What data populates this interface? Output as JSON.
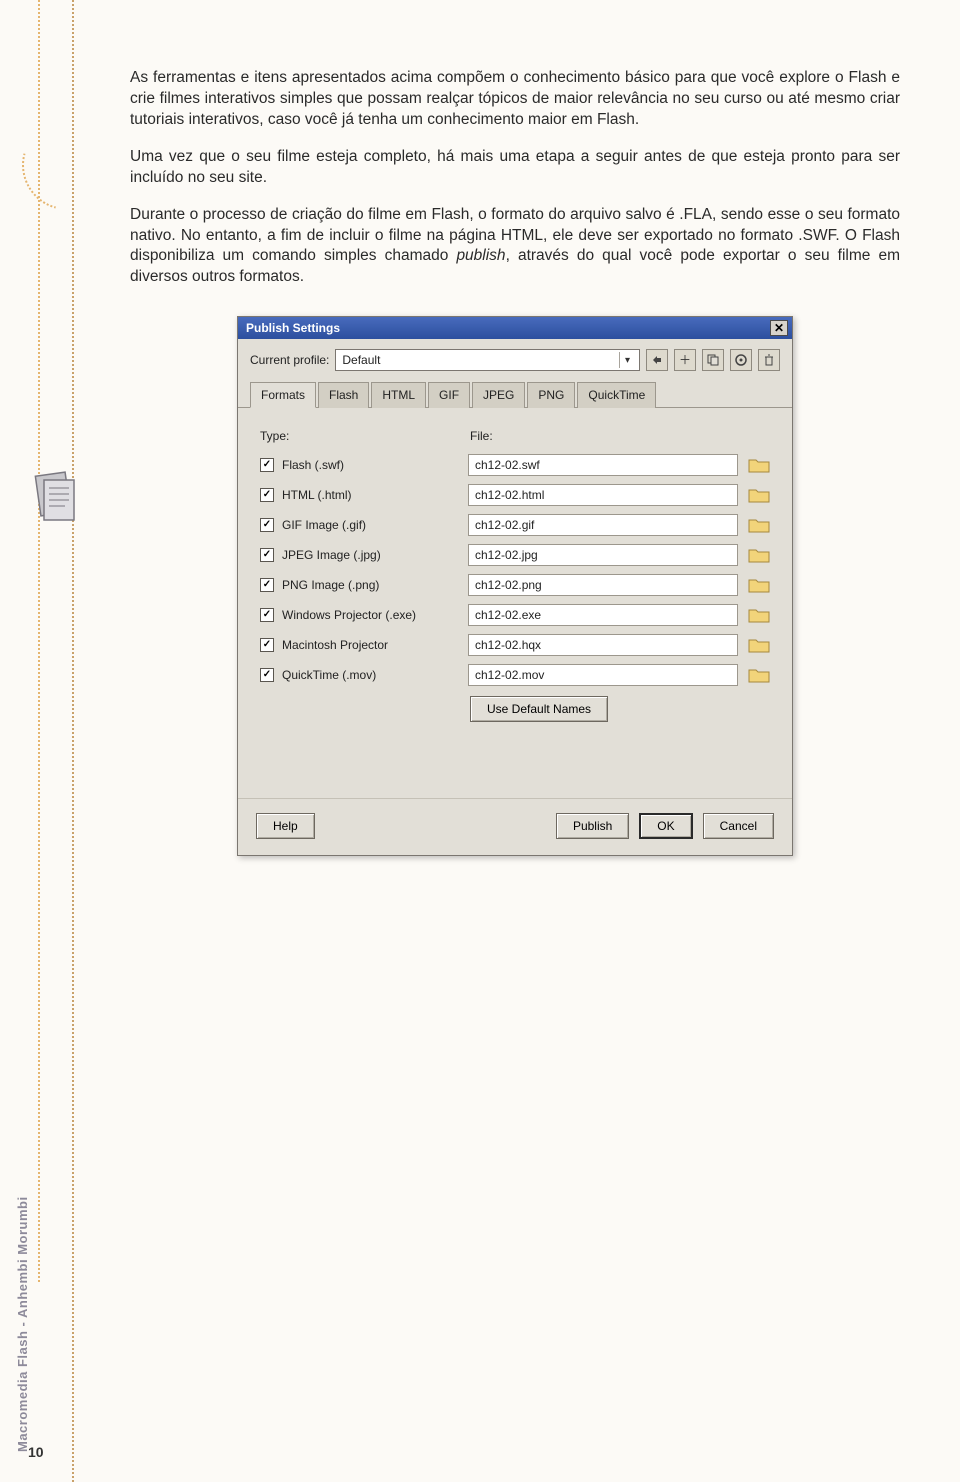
{
  "paragraphs": {
    "p1": "As ferramentas e itens apresentados acima compõem o conhecimento básico para que você explore o Flash e crie filmes interativos simples que possam realçar tópicos de maior relevância no seu curso ou até mesmo criar tutoriais interativos, caso você já tenha um conhecimento maior em Flash.",
    "p2": "Uma vez que o seu filme esteja completo, há mais uma etapa a seguir antes de que esteja pronto para ser incluído no seu site.",
    "p3_part1": "Durante o processo de criação do filme em Flash, o formato do arquivo salvo é .FLA, sendo esse o seu formato nativo. No entanto, a fim de incluir o filme na página HTML, ele deve ser exportado no formato .SWF. O Flash disponibiliza um comando simples chamado ",
    "p3_ital": "publish",
    "p3_part2": ", através do qual você pode exportar o seu filme em diversos outros formatos."
  },
  "sidebar": {
    "vertical_text": "Macromedia Flash - Anhembi Morumbi",
    "page_number": "10"
  },
  "dialog": {
    "title": "Publish Settings",
    "profile_label": "Current profile:",
    "profile_value": "Default",
    "tabs": [
      "Formats",
      "Flash",
      "HTML",
      "GIF",
      "JPEG",
      "PNG",
      "QuickTime"
    ],
    "col_type": "Type:",
    "col_file": "File:",
    "rows": [
      {
        "label": "Flash (.swf)",
        "file": "ch12-02.swf"
      },
      {
        "label": "HTML (.html)",
        "file": "ch12-02.html"
      },
      {
        "label": "GIF Image (.gif)",
        "file": "ch12-02.gif"
      },
      {
        "label": "JPEG Image (.jpg)",
        "file": "ch12-02.jpg"
      },
      {
        "label": "PNG Image (.png)",
        "file": "ch12-02.png"
      },
      {
        "label": "Windows Projector (.exe)",
        "file": "ch12-02.exe"
      },
      {
        "label": "Macintosh Projector",
        "file": "ch12-02.hqx"
      },
      {
        "label": "QuickTime (.mov)",
        "file": "ch12-02.mov"
      }
    ],
    "use_default": "Use Default Names",
    "buttons": {
      "help": "Help",
      "publish": "Publish",
      "ok": "OK",
      "cancel": "Cancel"
    }
  }
}
